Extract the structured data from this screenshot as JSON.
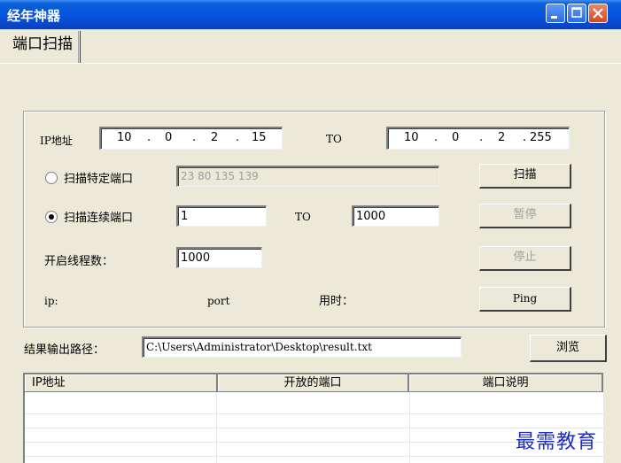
{
  "window": {
    "title": "经年神器"
  },
  "tabs": [
    {
      "label": "端口扫描"
    }
  ],
  "scan": {
    "ip_label": "IP地址",
    "ip_from": [
      "10",
      "0",
      "2",
      "15"
    ],
    "to_label": "TO",
    "ip_to": [
      "10",
      "0",
      "2",
      "255"
    ],
    "specific_ports_label": "扫描特定端口",
    "specific_ports_value": "23 80 135 139",
    "range_ports_label": "扫描连续端口",
    "port_from": "1",
    "port_to_label": "TO",
    "port_to": "1000",
    "threads_label": "开启线程数：",
    "threads_value": "1000",
    "ip_status_label": "ip:",
    "port_status_label": "port",
    "time_label": "用时：",
    "buttons": {
      "scan": "扫描",
      "pause": "暂停",
      "stop": "停止",
      "ping": "Ping"
    }
  },
  "output": {
    "label": "结果输出路径：",
    "path": "C:\\Users\\Administrator\\Desktop\\result.txt",
    "browse": "浏览"
  },
  "table": {
    "columns": [
      "IP地址",
      "开放的端口",
      "端口说明"
    ]
  },
  "watermark": "最需教育"
}
